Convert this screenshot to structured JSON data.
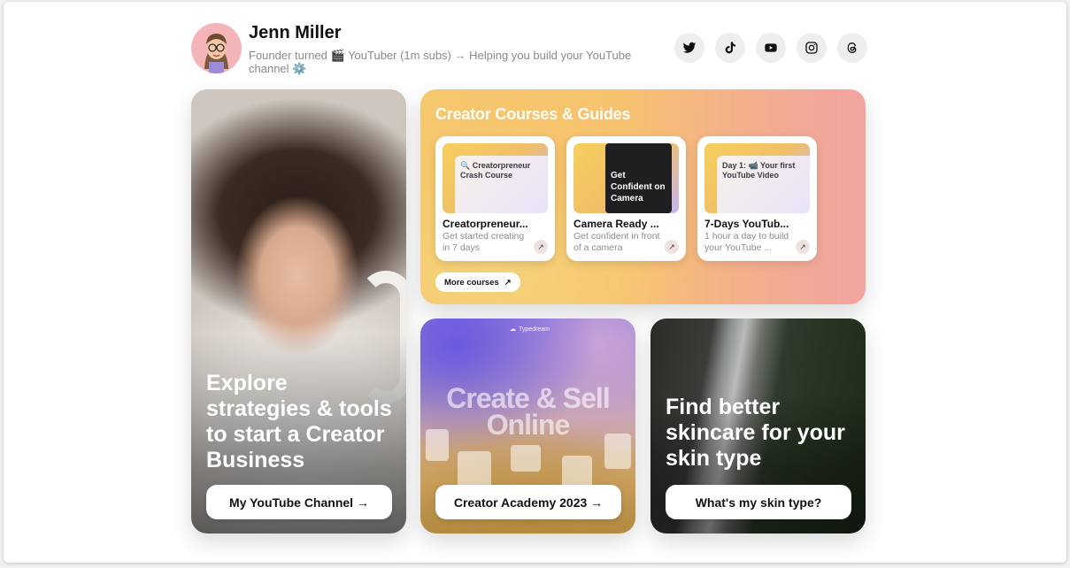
{
  "profile": {
    "name": "Jenn Miller",
    "bio": "Founder turned 🎬 YouTuber (1m subs) → Helping you build your YouTube channel ⚙️"
  },
  "socials": [
    {
      "icon": "twitter-icon"
    },
    {
      "icon": "tiktok-icon"
    },
    {
      "icon": "youtube-icon"
    },
    {
      "icon": "instagram-icon"
    },
    {
      "icon": "threads-icon"
    }
  ],
  "hero": {
    "title": "Explore strategies & tools to start a Creator Business",
    "button": "My YouTube Channel →"
  },
  "courses": {
    "title": "Creator Courses & Guides",
    "items": [
      {
        "thumb": "🔍 Creatorpreneur Crash Course",
        "title": "Creatorpreneur...",
        "desc": "Get started creating in 7 days"
      },
      {
        "thumb": "Get Confident on Camera",
        "title": "Camera Ready ...",
        "desc": "Get confident in front of a camera"
      },
      {
        "thumb": "Day 1: 📹 Your first YouTube Video",
        "title": "7-Days YouTub...",
        "desc": "1 hour a day to build your YouTube ..."
      }
    ],
    "more": "More courses"
  },
  "academy": {
    "logo": "Typedream",
    "headline": "Create & Sell Online",
    "button": "Creator Academy 2023 →"
  },
  "skincare": {
    "title": "Find better skincare for your skin type",
    "button": "What's my skin type?"
  },
  "colors": {
    "avatar_bg": "#f5b4b8",
    "courses_gradient_start": "#f6c86d",
    "courses_gradient_end": "#f2a3a0"
  }
}
